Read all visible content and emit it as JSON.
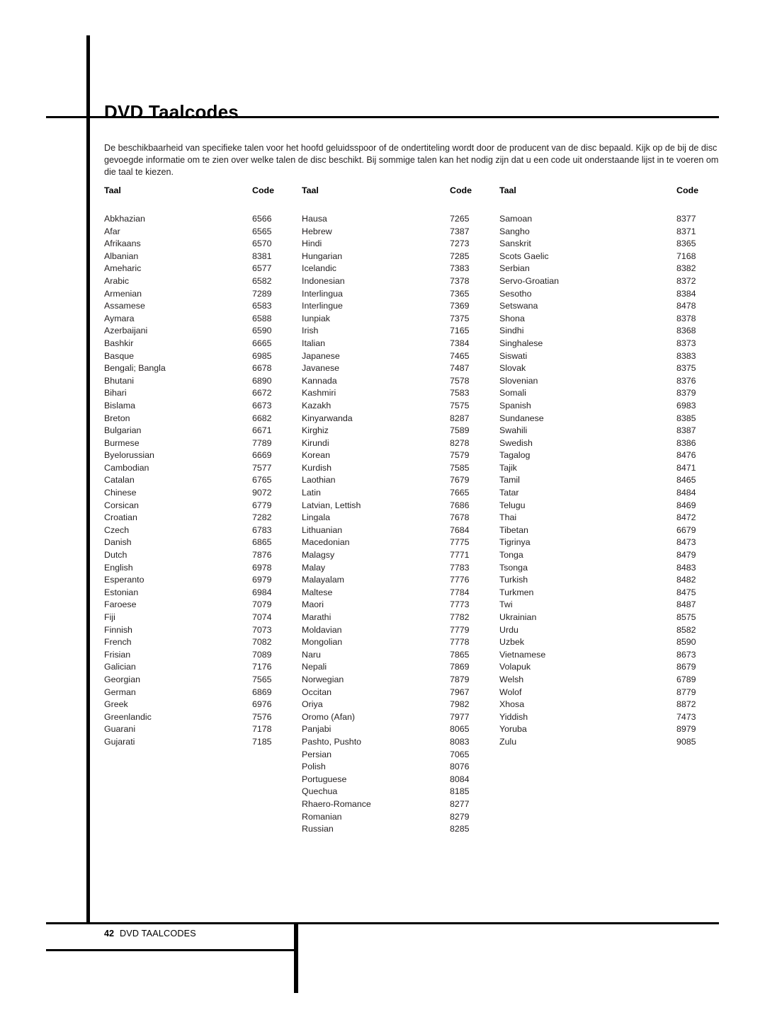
{
  "document": {
    "title": "DVD Taalcodes",
    "intro": "De beschikbaarheid van specifieke talen voor het hoofd geluidsspoor of de ondertiteling wordt door de producent van de disc bepaald. Kijk op de bij de disc gevoegde informatie om te zien over welke talen de disc beschikt. Bij sommige talen kan het nodig zijn dat u een code uit onderstaande lijst in te voeren om die taal te kiezen."
  },
  "table": {
    "headers": {
      "language": "Taal",
      "code": "Code"
    },
    "columns": [
      {
        "rows": [
          {
            "language": "Abkhazian",
            "code": "6566"
          },
          {
            "language": "Afar",
            "code": "6565"
          },
          {
            "language": "Afrikaans",
            "code": "6570"
          },
          {
            "language": "Albanian",
            "code": "8381"
          },
          {
            "language": "Ameharic",
            "code": "6577"
          },
          {
            "language": "Arabic",
            "code": "6582"
          },
          {
            "language": "Armenian",
            "code": "7289"
          },
          {
            "language": "Assamese",
            "code": "6583"
          },
          {
            "language": "Aymara",
            "code": "6588"
          },
          {
            "language": "Azerbaijani",
            "code": "6590"
          },
          {
            "language": "Bashkir",
            "code": "6665"
          },
          {
            "language": "Basque",
            "code": "6985"
          },
          {
            "language": "Bengali; Bangla",
            "code": "6678"
          },
          {
            "language": "Bhutani",
            "code": "6890"
          },
          {
            "language": "Bihari",
            "code": "6672"
          },
          {
            "language": "Bislama",
            "code": "6673"
          },
          {
            "language": "Breton",
            "code": "6682"
          },
          {
            "language": "Bulgarian",
            "code": "6671"
          },
          {
            "language": "Burmese",
            "code": "7789"
          },
          {
            "language": "Byelorussian",
            "code": "6669"
          },
          {
            "language": "Cambodian",
            "code": "7577"
          },
          {
            "language": "Catalan",
            "code": "6765"
          },
          {
            "language": "Chinese",
            "code": "9072"
          },
          {
            "language": "Corsican",
            "code": "6779"
          },
          {
            "language": "Croatian",
            "code": "7282"
          },
          {
            "language": "Czech",
            "code": "6783"
          },
          {
            "language": "Danish",
            "code": "6865"
          },
          {
            "language": "Dutch",
            "code": "7876"
          },
          {
            "language": "English",
            "code": "6978"
          },
          {
            "language": "Esperanto",
            "code": "6979"
          },
          {
            "language": "Estonian",
            "code": "6984"
          },
          {
            "language": "Faroese",
            "code": "7079"
          },
          {
            "language": "Fiji",
            "code": "7074"
          },
          {
            "language": "Finnish",
            "code": "7073"
          },
          {
            "language": "French",
            "code": "7082"
          },
          {
            "language": "Frisian",
            "code": "7089"
          },
          {
            "language": "Galician",
            "code": "7176"
          },
          {
            "language": "Georgian",
            "code": "7565"
          },
          {
            "language": "German",
            "code": "6869"
          },
          {
            "language": "Greek",
            "code": "6976"
          },
          {
            "language": "Greenlandic",
            "code": "7576"
          },
          {
            "language": "Guarani",
            "code": "7178"
          },
          {
            "language": "Gujarati",
            "code": "7185"
          }
        ]
      },
      {
        "rows": [
          {
            "language": "Hausa",
            "code": "7265"
          },
          {
            "language": "Hebrew",
            "code": "7387"
          },
          {
            "language": "Hindi",
            "code": "7273"
          },
          {
            "language": "Hungarian",
            "code": "7285"
          },
          {
            "language": "Icelandic",
            "code": "7383"
          },
          {
            "language": "Indonesian",
            "code": "7378"
          },
          {
            "language": "Interlingua",
            "code": "7365"
          },
          {
            "language": "Interlingue",
            "code": "7369"
          },
          {
            "language": "Iunpiak",
            "code": "7375"
          },
          {
            "language": "Irish",
            "code": "7165"
          },
          {
            "language": "Italian",
            "code": "7384"
          },
          {
            "language": "Japanese",
            "code": "7465"
          },
          {
            "language": "Javanese",
            "code": "7487"
          },
          {
            "language": "Kannada",
            "code": "7578"
          },
          {
            "language": "Kashmiri",
            "code": "7583"
          },
          {
            "language": "Kazakh",
            "code": "7575"
          },
          {
            "language": "Kinyarwanda",
            "code": "8287"
          },
          {
            "language": "Kirghiz",
            "code": "7589"
          },
          {
            "language": "Kirundi",
            "code": "8278"
          },
          {
            "language": "Korean",
            "code": "7579"
          },
          {
            "language": "Kurdish",
            "code": "7585"
          },
          {
            "language": "Laothian",
            "code": "7679"
          },
          {
            "language": "Latin",
            "code": "7665"
          },
          {
            "language": "Latvian, Lettish",
            "code": "7686"
          },
          {
            "language": "Lingala",
            "code": "7678"
          },
          {
            "language": "Lithuanian",
            "code": "7684"
          },
          {
            "language": "Macedonian",
            "code": "7775"
          },
          {
            "language": "Malagsy",
            "code": "7771"
          },
          {
            "language": "Malay",
            "code": "7783"
          },
          {
            "language": "Malayalam",
            "code": "7776"
          },
          {
            "language": "Maltese",
            "code": "7784"
          },
          {
            "language": "Maori",
            "code": "7773"
          },
          {
            "language": "Marathi",
            "code": "7782"
          },
          {
            "language": "Moldavian",
            "code": "7779"
          },
          {
            "language": "Mongolian",
            "code": "7778"
          },
          {
            "language": "Naru",
            "code": "7865"
          },
          {
            "language": "Nepali",
            "code": "7869"
          },
          {
            "language": "Norwegian",
            "code": "7879"
          },
          {
            "language": "Occitan",
            "code": "7967"
          },
          {
            "language": "Oriya",
            "code": "7982"
          },
          {
            "language": "Oromo (Afan)",
            "code": "7977"
          },
          {
            "language": "Panjabi",
            "code": "8065"
          },
          {
            "language": "Pashto, Pushto",
            "code": "8083"
          },
          {
            "language": "Persian",
            "code": "7065"
          },
          {
            "language": "Polish",
            "code": "8076"
          },
          {
            "language": "Portuguese",
            "code": "8084"
          },
          {
            "language": "Quechua",
            "code": "8185"
          },
          {
            "language": "Rhaero-Romance",
            "code": "8277"
          },
          {
            "language": "Romanian",
            "code": "8279"
          },
          {
            "language": "Russian",
            "code": "8285"
          }
        ]
      },
      {
        "rows": [
          {
            "language": "Samoan",
            "code": "8377"
          },
          {
            "language": "Sangho",
            "code": "8371"
          },
          {
            "language": "Sanskrit",
            "code": "8365"
          },
          {
            "language": "Scots Gaelic",
            "code": "7168"
          },
          {
            "language": "Serbian",
            "code": "8382"
          },
          {
            "language": "Servo-Groatian",
            "code": "8372"
          },
          {
            "language": "Sesotho",
            "code": "8384"
          },
          {
            "language": "Setswana",
            "code": "8478"
          },
          {
            "language": "Shona",
            "code": "8378"
          },
          {
            "language": "Sindhi",
            "code": "8368"
          },
          {
            "language": "Singhalese",
            "code": "8373"
          },
          {
            "language": "Siswati",
            "code": "8383"
          },
          {
            "language": "Slovak",
            "code": "8375"
          },
          {
            "language": "Slovenian",
            "code": "8376"
          },
          {
            "language": "Somali",
            "code": "8379"
          },
          {
            "language": "Spanish",
            "code": "6983"
          },
          {
            "language": "Sundanese",
            "code": "8385"
          },
          {
            "language": "Swahili",
            "code": "8387"
          },
          {
            "language": "Swedish",
            "code": "8386"
          },
          {
            "language": "Tagalog",
            "code": "8476"
          },
          {
            "language": "Tajik",
            "code": "8471"
          },
          {
            "language": "Tamil",
            "code": "8465"
          },
          {
            "language": "Tatar",
            "code": "8484"
          },
          {
            "language": "Telugu",
            "code": "8469"
          },
          {
            "language": "Thai",
            "code": "8472"
          },
          {
            "language": "Tibetan",
            "code": "6679"
          },
          {
            "language": "Tigrinya",
            "code": "8473"
          },
          {
            "language": "Tonga",
            "code": "8479"
          },
          {
            "language": "Tsonga",
            "code": "8483"
          },
          {
            "language": "Turkish",
            "code": "8482"
          },
          {
            "language": "Turkmen",
            "code": "8475"
          },
          {
            "language": "Twi",
            "code": "8487"
          },
          {
            "language": "Ukrainian",
            "code": "8575"
          },
          {
            "language": "Urdu",
            "code": "8582"
          },
          {
            "language": "Uzbek",
            "code": "8590"
          },
          {
            "language": "Vietnamese",
            "code": "8673"
          },
          {
            "language": "Volapuk",
            "code": "8679"
          },
          {
            "language": "Welsh",
            "code": "6789"
          },
          {
            "language": "Wolof",
            "code": "8779"
          },
          {
            "language": "Xhosa",
            "code": "8872"
          },
          {
            "language": "Yiddish",
            "code": "7473"
          },
          {
            "language": "Yoruba",
            "code": "8979"
          },
          {
            "language": "Zulu",
            "code": "9085"
          }
        ]
      }
    ]
  },
  "footer": {
    "page_number": "42",
    "section_label": "DVD TAALCODES"
  }
}
